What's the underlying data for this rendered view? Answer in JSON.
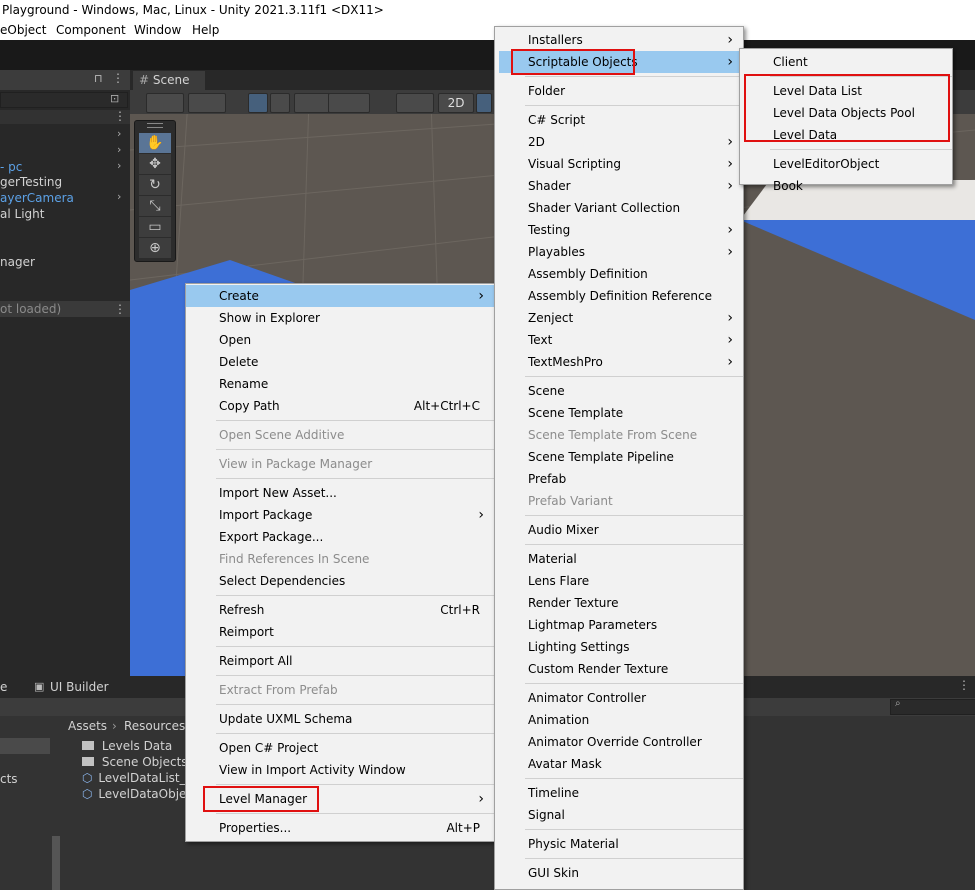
{
  "window_title": "Playground - Windows, Mac, Linux - Unity 2021.3.11f1 <DX11>",
  "menubar": [
    "eObject",
    "Component",
    "Window",
    "Help"
  ],
  "hierarchy": {
    "items": [
      {
        "label": "- pc",
        "style": "blue"
      },
      {
        "label": "gerTesting",
        "style": "normal"
      },
      {
        "label": "ayerCamera",
        "style": "blue"
      },
      {
        "label": "al Light",
        "style": "normal"
      },
      {
        "label": "nager",
        "style": "normal"
      },
      {
        "label": "ot loaded)",
        "style": "dim"
      }
    ]
  },
  "scene": {
    "tab_label": "Scene",
    "mode_2d": "2D"
  },
  "bottom": {
    "tab_partial": "e",
    "ui_builder_label": "UI Builder",
    "breadcrumb": [
      "Assets",
      "Resources"
    ],
    "left_partial": "cts",
    "assets": [
      {
        "label": "Levels Data",
        "icon": "folder-icon"
      },
      {
        "label": "Scene Objects",
        "icon": "folder-icon"
      },
      {
        "label": "LevelDataList_S",
        "icon": "scriptable-object-icon"
      },
      {
        "label": "LevelDataObjec",
        "icon": "scriptable-object-icon"
      }
    ]
  },
  "context_menu": {
    "items": [
      {
        "label": "Create",
        "arrow": true,
        "highlight": true
      },
      {
        "label": "Show in Explorer"
      },
      {
        "label": "Open"
      },
      {
        "label": "Delete"
      },
      {
        "label": "Rename"
      },
      {
        "label": "Copy Path",
        "shortcut": "Alt+Ctrl+C"
      },
      {
        "label": "Open Scene Additive",
        "disabled": true,
        "sep_before": true
      },
      {
        "label": "View in Package Manager",
        "disabled": true,
        "sep_before": true
      },
      {
        "label": "Import New Asset...",
        "sep_before": true
      },
      {
        "label": "Import Package",
        "arrow": true
      },
      {
        "label": "Export Package..."
      },
      {
        "label": "Find References In Scene",
        "disabled": true
      },
      {
        "label": "Select Dependencies"
      },
      {
        "label": "Refresh",
        "shortcut": "Ctrl+R",
        "sep_before": true
      },
      {
        "label": "Reimport"
      },
      {
        "label": "Reimport All",
        "sep_before": true
      },
      {
        "label": "Extract From Prefab",
        "disabled": true,
        "sep_before": true
      },
      {
        "label": "Update UXML Schema",
        "sep_before": true
      },
      {
        "label": "Open C# Project",
        "sep_before": true
      },
      {
        "label": "View in Import Activity Window"
      },
      {
        "label": "Level Manager",
        "arrow": true,
        "sep_before": true,
        "boxed": true
      },
      {
        "label": "Properties...",
        "shortcut": "Alt+P",
        "sep_before": true
      }
    ]
  },
  "create_menu": {
    "items": [
      {
        "label": "Installers",
        "arrow": true
      },
      {
        "label": "Scriptable Objects",
        "arrow": true,
        "highlight": true,
        "boxed": true
      },
      {
        "label": "Folder",
        "sep_before": true
      },
      {
        "label": "C# Script",
        "sep_before": true
      },
      {
        "label": "2D",
        "arrow": true
      },
      {
        "label": "Visual Scripting",
        "arrow": true
      },
      {
        "label": "Shader",
        "arrow": true
      },
      {
        "label": "Shader Variant Collection"
      },
      {
        "label": "Testing",
        "arrow": true
      },
      {
        "label": "Playables",
        "arrow": true
      },
      {
        "label": "Assembly Definition"
      },
      {
        "label": "Assembly Definition Reference"
      },
      {
        "label": "Zenject",
        "arrow": true
      },
      {
        "label": "Text",
        "arrow": true
      },
      {
        "label": "TextMeshPro",
        "arrow": true
      },
      {
        "label": "Scene",
        "sep_before": true
      },
      {
        "label": "Scene Template"
      },
      {
        "label": "Scene Template From Scene",
        "disabled": true
      },
      {
        "label": "Scene Template Pipeline"
      },
      {
        "label": "Prefab"
      },
      {
        "label": "Prefab Variant",
        "disabled": true
      },
      {
        "label": "Audio Mixer",
        "sep_before": true
      },
      {
        "label": "Material",
        "sep_before": true
      },
      {
        "label": "Lens Flare"
      },
      {
        "label": "Render Texture"
      },
      {
        "label": "Lightmap Parameters"
      },
      {
        "label": "Lighting Settings"
      },
      {
        "label": "Custom Render Texture"
      },
      {
        "label": "Animator Controller",
        "sep_before": true
      },
      {
        "label": "Animation"
      },
      {
        "label": "Animator Override Controller"
      },
      {
        "label": "Avatar Mask"
      },
      {
        "label": "Timeline",
        "sep_before": true
      },
      {
        "label": "Signal"
      },
      {
        "label": "Physic Material",
        "sep_before": true
      },
      {
        "label": "GUI Skin",
        "sep_before": true
      }
    ]
  },
  "scriptable_menu": {
    "items": [
      {
        "label": "Client"
      },
      {
        "label": "Level Data List",
        "sep_before": true,
        "boxed_group": true
      },
      {
        "label": "Level Data Objects Pool",
        "boxed_group": true
      },
      {
        "label": "Level Data",
        "boxed_group": true
      },
      {
        "label": "LevelEditorObject",
        "sep_before": true
      },
      {
        "label": "Book"
      }
    ]
  }
}
